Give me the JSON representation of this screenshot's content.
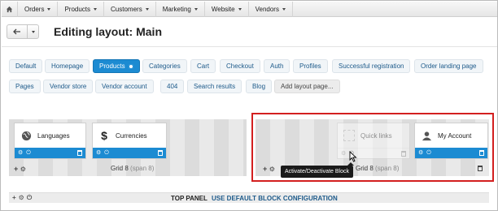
{
  "menu": {
    "home_icon": "home-icon",
    "items": [
      {
        "label": "Orders"
      },
      {
        "label": "Products"
      },
      {
        "label": "Customers"
      },
      {
        "label": "Marketing"
      },
      {
        "label": "Website"
      },
      {
        "label": "Vendors"
      }
    ]
  },
  "header": {
    "title": "Editing layout: Main"
  },
  "tabs": [
    {
      "label": "Default"
    },
    {
      "label": "Homepage"
    },
    {
      "label": "Products",
      "active": true
    },
    {
      "label": "Categories"
    },
    {
      "label": "Cart"
    },
    {
      "label": "Checkout"
    },
    {
      "label": "Auth"
    },
    {
      "label": "Profiles"
    },
    {
      "label": "Successful registration"
    },
    {
      "label": "Order landing page"
    },
    {
      "label": "Pages"
    },
    {
      "label": "Vendor store"
    },
    {
      "label": "Vendor account"
    },
    {
      "label": "404"
    },
    {
      "label": "Search results"
    },
    {
      "label": "Blog"
    },
    {
      "label": "Add layout page..."
    }
  ],
  "grids": {
    "left": {
      "blocks": [
        {
          "name": "Languages",
          "icon": "globe-icon"
        },
        {
          "name": "Currencies",
          "icon": "dollar-icon"
        }
      ],
      "label": "Grid 8",
      "span": "(span 8)"
    },
    "right": {
      "blocks": [
        {
          "name": "Quick links",
          "icon": "placeholder-icon",
          "inactive": true
        },
        {
          "name": "My Account",
          "icon": "user-icon"
        }
      ],
      "label": "Grid 8",
      "span": "(span 8)"
    }
  },
  "tooltip": "Activate/Deactivate Block",
  "bottom_panel": {
    "title": "TOP PANEL",
    "link": "USE DEFAULT BLOCK CONFIGURATION"
  },
  "colors": {
    "accent": "#1c8bd2",
    "highlight": "#d31f1f"
  }
}
